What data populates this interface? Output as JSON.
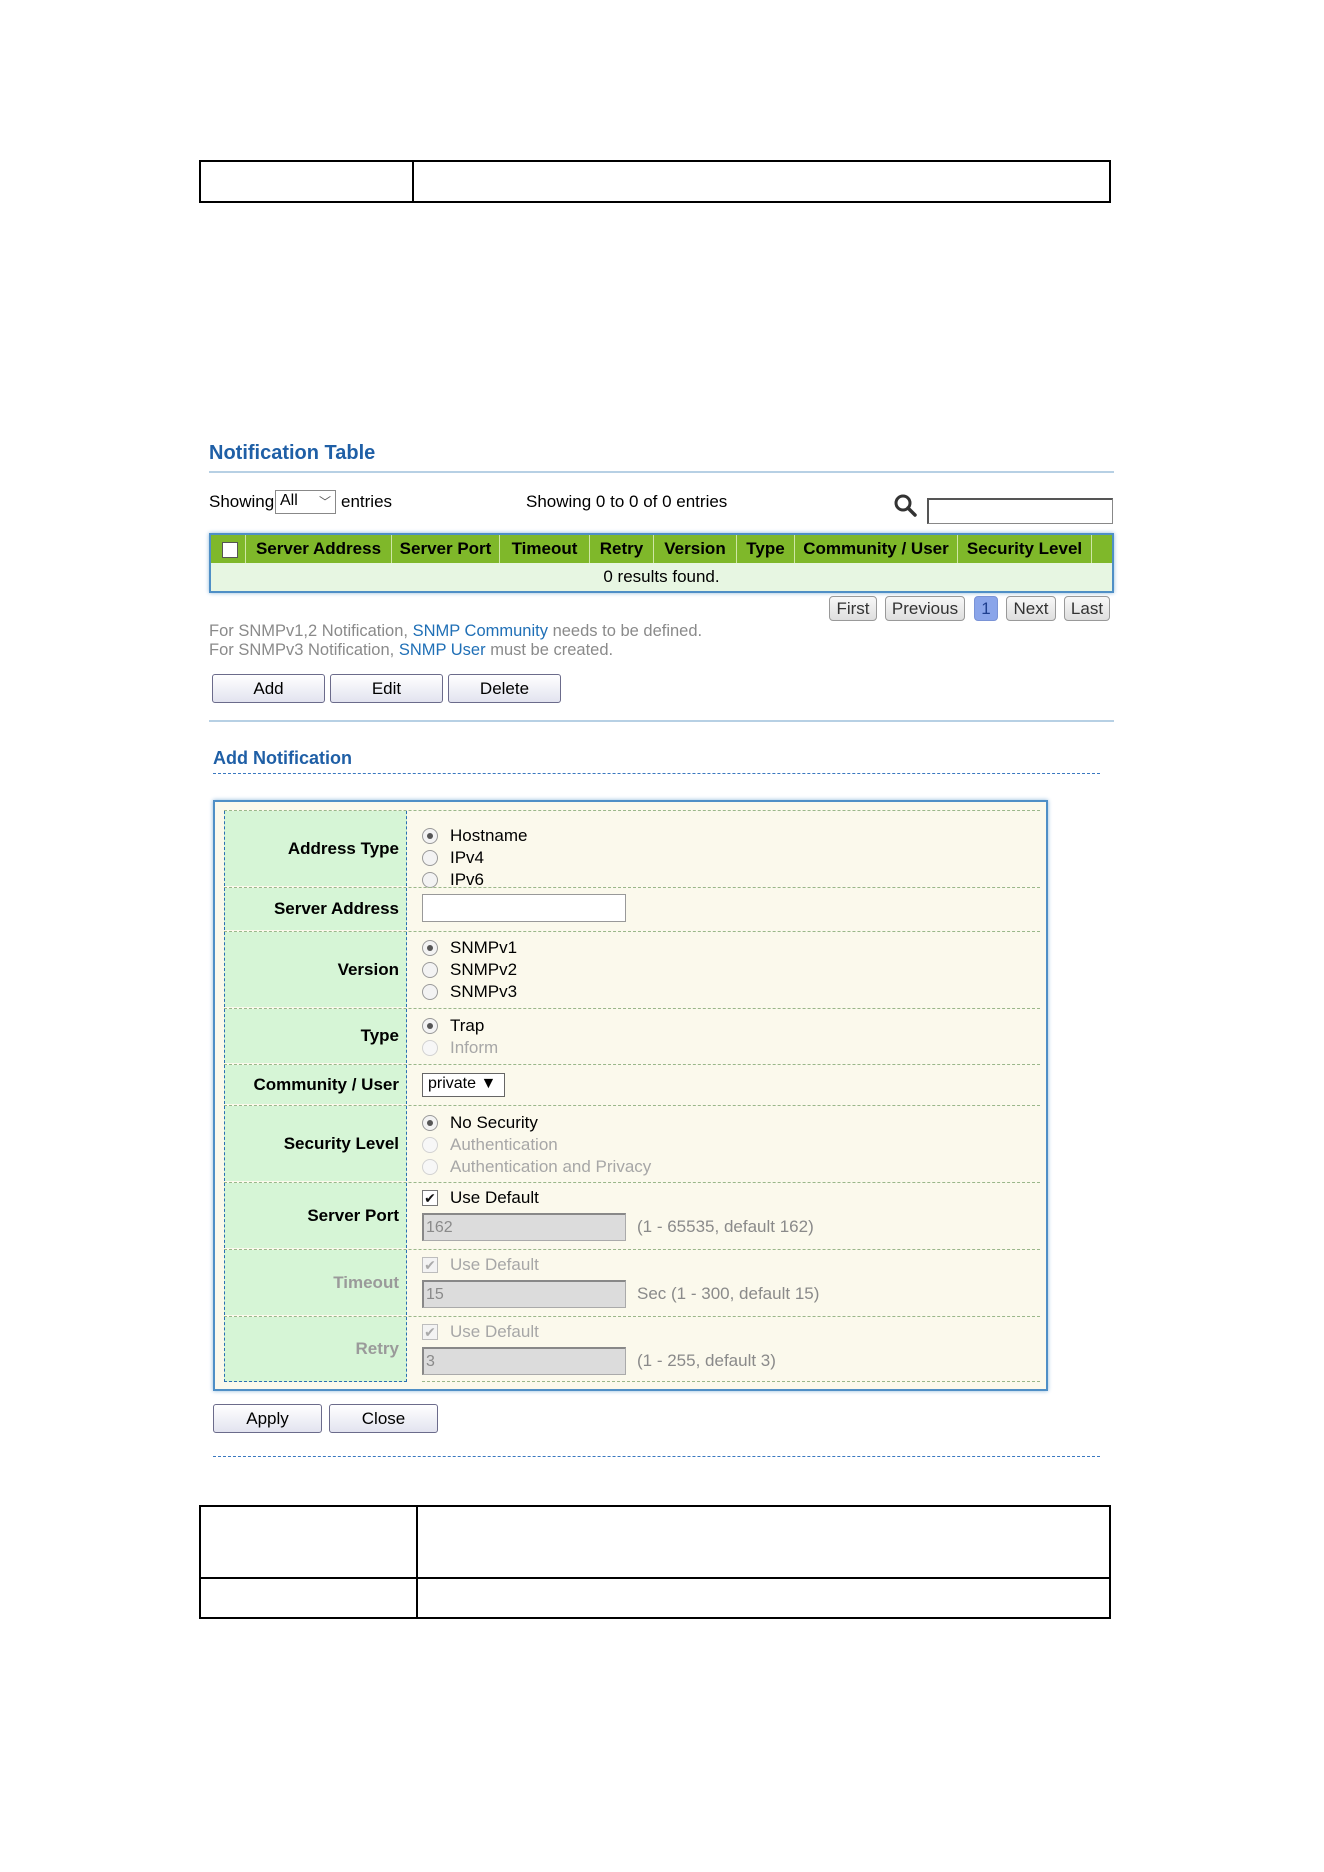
{
  "notification_table": {
    "title": "Notification Table",
    "showing_prefix": "Showing",
    "entries_value": "All",
    "entries_suffix": "entries",
    "showing_count": "Showing 0 to 0 of 0 entries",
    "columns": [
      "Server Address",
      "Server Port",
      "Timeout",
      "Retry",
      "Version",
      "Type",
      "Community / User",
      "Security Level"
    ],
    "empty_message": "0 results found.",
    "pagination": {
      "first": "First",
      "previous": "Previous",
      "current": "1",
      "next": "Next",
      "last": "Last"
    },
    "note1": {
      "prefix": "For SNMPv1,2 Notification, ",
      "link": "SNMP Community",
      "suffix": " needs to be defined."
    },
    "note2": {
      "prefix": "For SNMPv3 Notification, ",
      "link": "SNMP User",
      "suffix": " must be created."
    },
    "buttons": {
      "add": "Add",
      "edit": "Edit",
      "delete": "Delete"
    }
  },
  "add_notification": {
    "title": "Add Notification",
    "address_type": {
      "label": "Address Type",
      "options": [
        "Hostname",
        "IPv4",
        "IPv6"
      ],
      "selected": "Hostname"
    },
    "server_address": {
      "label": "Server Address",
      "value": ""
    },
    "version": {
      "label": "Version",
      "options": [
        "SNMPv1",
        "SNMPv2",
        "SNMPv3"
      ],
      "selected": "SNMPv1"
    },
    "type": {
      "label": "Type",
      "options": [
        "Trap",
        "Inform"
      ],
      "selected": "Trap"
    },
    "community_user": {
      "label": "Community / User",
      "value": "private ▼"
    },
    "security_level": {
      "label": "Security Level",
      "options": [
        "No Security",
        "Authentication",
        "Authentication and Privacy"
      ],
      "selected": "No Security"
    },
    "server_port": {
      "label": "Server Port",
      "use_default": "Use Default",
      "value": "162",
      "hint": "(1 - 65535, default 162)"
    },
    "timeout": {
      "label": "Timeout",
      "use_default": "Use Default",
      "value": "15",
      "hint": "Sec (1 - 300, default 15)"
    },
    "retry": {
      "label": "Retry",
      "use_default": "Use Default",
      "value": "3",
      "hint": "(1 - 255, default 3)"
    },
    "buttons": {
      "apply": "Apply",
      "close": "Close"
    }
  },
  "colors": {
    "accent": "#1f5fa6",
    "grid_header": "#7fb82a",
    "label_bg": "#d6f5d6",
    "form_bg": "#fbf9ec"
  }
}
